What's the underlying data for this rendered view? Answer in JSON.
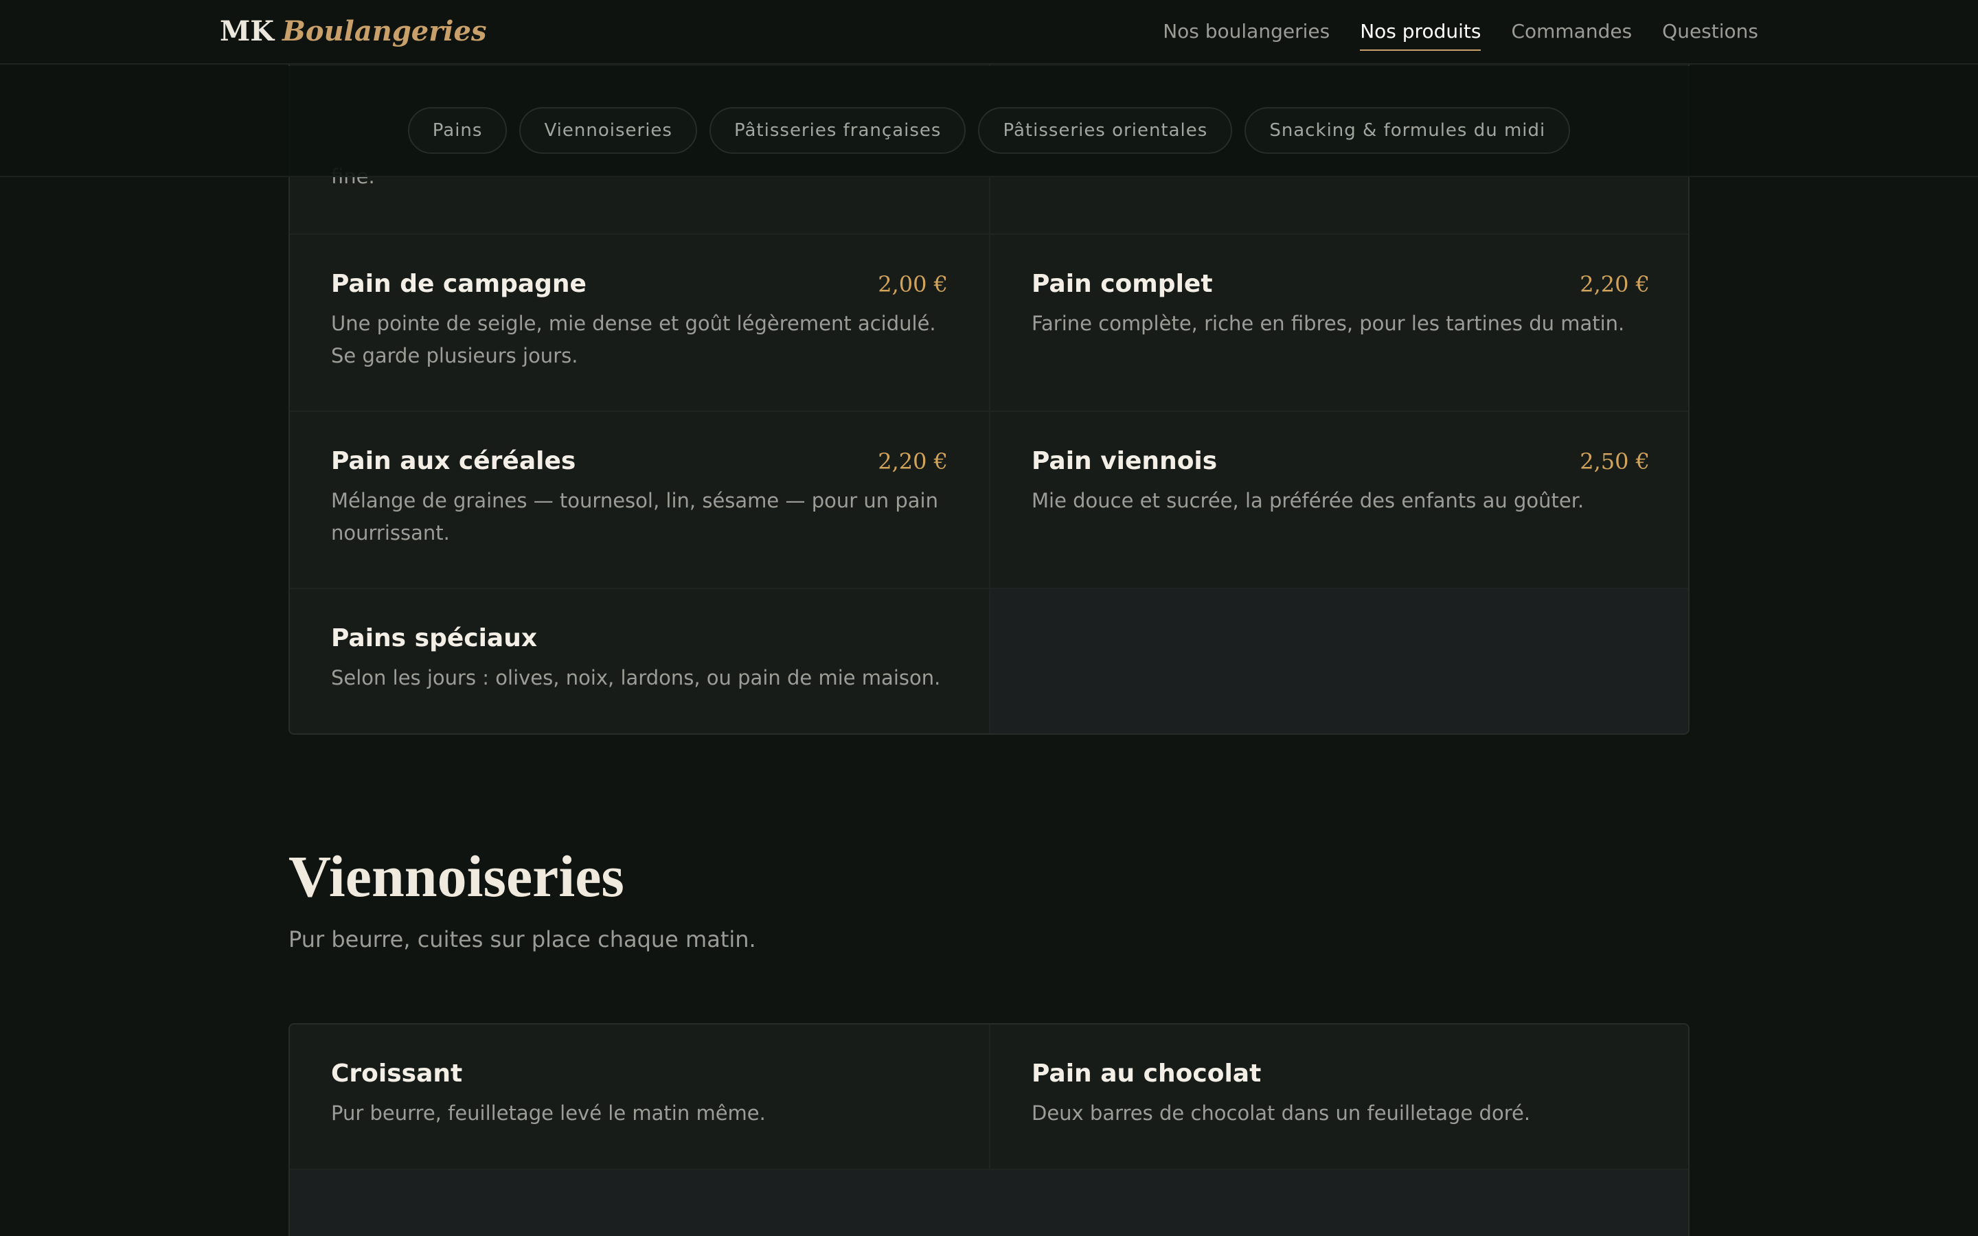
{
  "header": {
    "brand_mk": "MK",
    "brand_accent": "Boulangeries",
    "nav": [
      {
        "label": "Nos boulangeries",
        "active": false
      },
      {
        "label": "Nos produits",
        "active": true
      },
      {
        "label": "Commandes",
        "active": false
      },
      {
        "label": "Questions",
        "active": false
      }
    ]
  },
  "categories": [
    "Pains",
    "Viennoiseries",
    "Pâtisseries françaises",
    "Pâtisseries orientales",
    "Snacking & formules du midi"
  ],
  "pains": {
    "partial_top_left_desc": "fine.",
    "items": [
      {
        "name": "Pain de campagne",
        "price": "2,00 €",
        "desc": "Une pointe de seigle, mie dense et goût légèrement acidulé. Se garde plusieurs jours."
      },
      {
        "name": "Pain complet",
        "price": "2,20 €",
        "desc": "Farine complète, riche en fibres, pour les tartines du matin."
      },
      {
        "name": "Pain aux céréales",
        "price": "2,20 €",
        "desc": "Mélange de graines — tournesol, lin, sésame — pour un pain nourrissant."
      },
      {
        "name": "Pain viennois",
        "price": "2,50 €",
        "desc": "Mie douce et sucrée, la préférée des enfants au goûter."
      },
      {
        "name": "Pains spéciaux",
        "price": "",
        "desc": "Selon les jours : olives, noix, lardons, ou pain de mie maison."
      }
    ]
  },
  "viennoiseries": {
    "title": "Viennoiseries",
    "subtitle": "Pur beurre, cuites sur place chaque matin.",
    "items": [
      {
        "name": "Croissant",
        "price": "",
        "desc": "Pur beurre, feuilletage levé le matin même."
      },
      {
        "name": "Pain au chocolat",
        "price": "",
        "desc": "Deux barres de chocolat dans un feuilletage doré."
      }
    ]
  },
  "colors": {
    "background": "#0f1411",
    "accent": "#c9a06a",
    "price": "#d2a35b",
    "card": "#171c19"
  }
}
